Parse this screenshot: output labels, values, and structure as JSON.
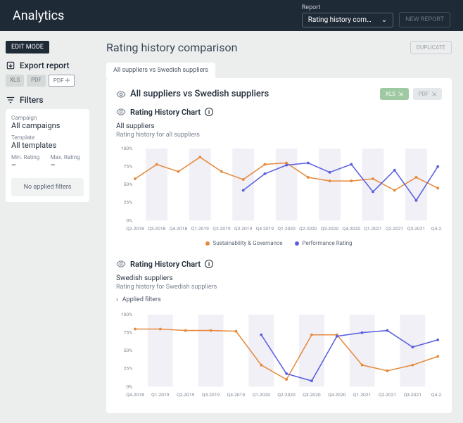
{
  "topbar": {
    "app": "Analytics",
    "report_label": "Report",
    "report_selected": "Rating history com…",
    "new_report": "NEW REPORT"
  },
  "sidebar": {
    "edit_mode": "EDIT MODE",
    "export": {
      "title": "Export report",
      "xls": "XLS",
      "pdf": "PDF",
      "pdf_cfg": "PDF ✢"
    },
    "filters_title": "Filters",
    "filters": {
      "campaign_lbl": "Campaign",
      "campaign_val": "All campaigns",
      "template_lbl": "Template",
      "template_val": "All templates",
      "min_lbl": "Min. Rating",
      "min_val": "–",
      "max_lbl": "Max. Rating",
      "max_val": "–",
      "none": "No applied filters"
    }
  },
  "main": {
    "title": "Rating history comparison",
    "duplicate": "DUPLICATE",
    "tab": "All suppliers vs Swedish suppliers",
    "section": "All suppliers vs Swedish suppliers",
    "xls_btn": "XLS",
    "pdf_btn": "PDF",
    "chart_label": "Rating History Chart",
    "chart1": {
      "title": "All suppliers",
      "subtitle": "Rating history for all suppliers"
    },
    "chart2": {
      "title": "Swedish suppliers",
      "subtitle": "Rating history for Swedish suppliers",
      "applied": "Applied filters"
    },
    "legend": {
      "a": "Sustainability & Governance",
      "b": "Performance Rating"
    }
  },
  "chart_data": [
    {
      "type": "line",
      "title": "All suppliers — Rating history",
      "ylabel": "%",
      "ylim": [
        0,
        100
      ],
      "categories": [
        "Q2-2018",
        "Q3-2018",
        "Q4-2018",
        "Q1-2019",
        "Q2-2019",
        "Q3-2019",
        "Q4-2019",
        "Q1-2020",
        "Q2-2020",
        "Q3-2020",
        "Q4-2020",
        "Q1-2021",
        "Q2-2021",
        "Q3-2021",
        "Q4-2…"
      ],
      "series": [
        {
          "name": "Sustainability & Governance",
          "color": "#e78a3b",
          "values": [
            58,
            78,
            68,
            88,
            68,
            57,
            78,
            80,
            60,
            55,
            55,
            58,
            42,
            60,
            45
          ]
        },
        {
          "name": "Performance Rating",
          "color": "#5a5fe0",
          "values": [
            null,
            null,
            null,
            null,
            null,
            42,
            65,
            77,
            80,
            67,
            78,
            40,
            70,
            28,
            75
          ]
        }
      ]
    },
    {
      "type": "line",
      "title": "Swedish suppliers — Rating history",
      "ylabel": "%",
      "ylim": [
        0,
        100
      ],
      "categories": [
        "Q4-2018",
        "Q1-2019",
        "Q2-2019",
        "Q3-2019",
        "Q4-2019",
        "Q1-2020",
        "Q2-2020",
        "Q3-2020",
        "Q4-2020",
        "Q1-2021",
        "Q2-2021",
        "Q3-2021",
        "Q4-2…"
      ],
      "series": [
        {
          "name": "Sustainability & Governance",
          "color": "#e78a3b",
          "values": [
            80,
            80,
            78,
            78,
            77,
            30,
            10,
            72,
            72,
            30,
            22,
            30,
            42
          ]
        },
        {
          "name": "Performance Rating",
          "color": "#5a5fe0",
          "values": [
            null,
            null,
            null,
            null,
            null,
            72,
            18,
            8,
            70,
            75,
            78,
            55,
            65
          ]
        }
      ]
    }
  ]
}
